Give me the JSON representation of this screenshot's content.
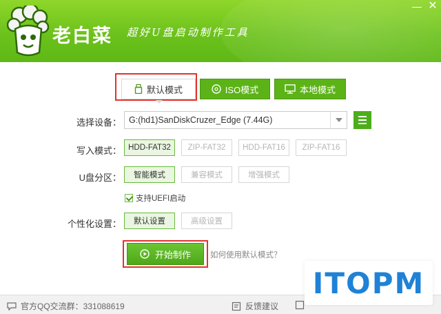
{
  "header": {
    "app_title": "老白菜",
    "slogan": "超好U盘启动制作工具",
    "minimize_glyph": "—",
    "close_glyph": "✕",
    "icons": [
      "broccoli-logo-icon"
    ]
  },
  "mode_tabs": [
    {
      "label": "默认模式",
      "icon": "usb-drive-icon",
      "active": true
    },
    {
      "label": "ISO模式",
      "icon": "disc-icon",
      "active": false
    },
    {
      "label": "本地模式",
      "icon": "monitor-icon",
      "active": false
    }
  ],
  "device": {
    "label": "选择设备：",
    "value": "G:(hd1)SanDiskCruzer_Edge (7.44G)"
  },
  "write_mode": {
    "label": "写入模式：",
    "options": [
      {
        "label": "HDD-FAT32",
        "selected": true
      },
      {
        "label": "ZIP-FAT32",
        "selected": false
      },
      {
        "label": "HDD-FAT16",
        "selected": false
      },
      {
        "label": "ZIP-FAT16",
        "selected": false
      }
    ]
  },
  "partition": {
    "label": "U盘分区：",
    "options": [
      {
        "label": "智能模式",
        "selected": true
      },
      {
        "label": "兼容模式",
        "selected": false
      },
      {
        "label": "增强模式",
        "selected": false
      }
    ]
  },
  "uefi": {
    "label": "支持UEFI启动",
    "checked": true
  },
  "personalize": {
    "label": "个性化设置：",
    "options": [
      {
        "label": "默认设置",
        "selected": true
      },
      {
        "label": "高级设置",
        "selected": false
      }
    ]
  },
  "start_button": {
    "label": "开始制作",
    "icon": "play-circle-icon"
  },
  "help_link": "如何使用默认模式？",
  "watermark": "ITOPM",
  "footer": {
    "qq_group": "官方QQ交流群：331088619",
    "feedback": "反馈建议"
  },
  "colors": {
    "brand_green": "#6cc21c",
    "tab_green": "#5cb317",
    "highlight_red": "#e0332d",
    "watermark_blue": "#1f82d6"
  }
}
